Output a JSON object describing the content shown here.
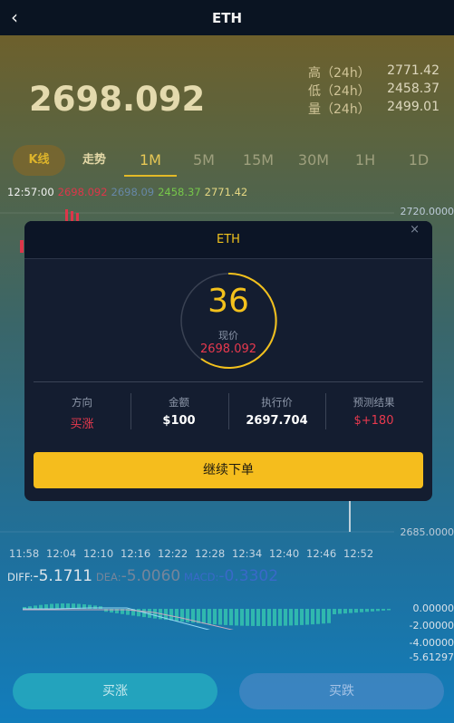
{
  "header": {
    "title": "ETH",
    "back_icon": "chevron-left-icon"
  },
  "ticker": {
    "price": "2698.092",
    "high_label": "高（24h）",
    "high_value": "2771.42",
    "low_label": "低（24h）",
    "low_value": "2458.37",
    "vol_label": "量（24h）",
    "vol_value": "2499.01"
  },
  "tabs": [
    "K线",
    "走势",
    "1M",
    "5M",
    "15M",
    "30M",
    "1H",
    "1D"
  ],
  "active_tab": "1M",
  "ohlc": {
    "time": "12:57:00",
    "open": "2698.092",
    "close": "2698.09",
    "low": "2458.37",
    "high": "2771.42"
  },
  "y_axis_labels": [
    "2720.0000",
    "2685.0000"
  ],
  "x_axis_labels": [
    "11:58",
    "12:04",
    "12:10",
    "12:16",
    "12:22",
    "12:28",
    "12:34",
    "12:40",
    "12:46",
    "12:52"
  ],
  "macd": {
    "diff_label": "DIFF:",
    "diff_value": "-5.1711",
    "dea_label": "DEA:",
    "dea_value": "-5.0060",
    "macd_label": "MACD:",
    "macd_value": "-0.3302",
    "axis": [
      "0.00000",
      "-2.00000",
      "-4.00000",
      "-5.61297"
    ]
  },
  "modal": {
    "title": "ETH",
    "close_icon": "close-icon",
    "countdown": "36",
    "current_label": "现价",
    "current_value": "2698.092",
    "direction_label": "方向",
    "direction_value": "买涨",
    "amount_label": "金额",
    "amount_value": "$100",
    "strike_label": "执行价",
    "strike_value": "2697.704",
    "result_label": "预测结果",
    "result_value": "$+180",
    "continue_label": "继续下单"
  },
  "actions": {
    "buy_up": "买涨",
    "buy_down": "买跌"
  },
  "colors": {
    "accent": "#f5bd1d",
    "up": "#e8394e",
    "down": "#4caf50"
  }
}
